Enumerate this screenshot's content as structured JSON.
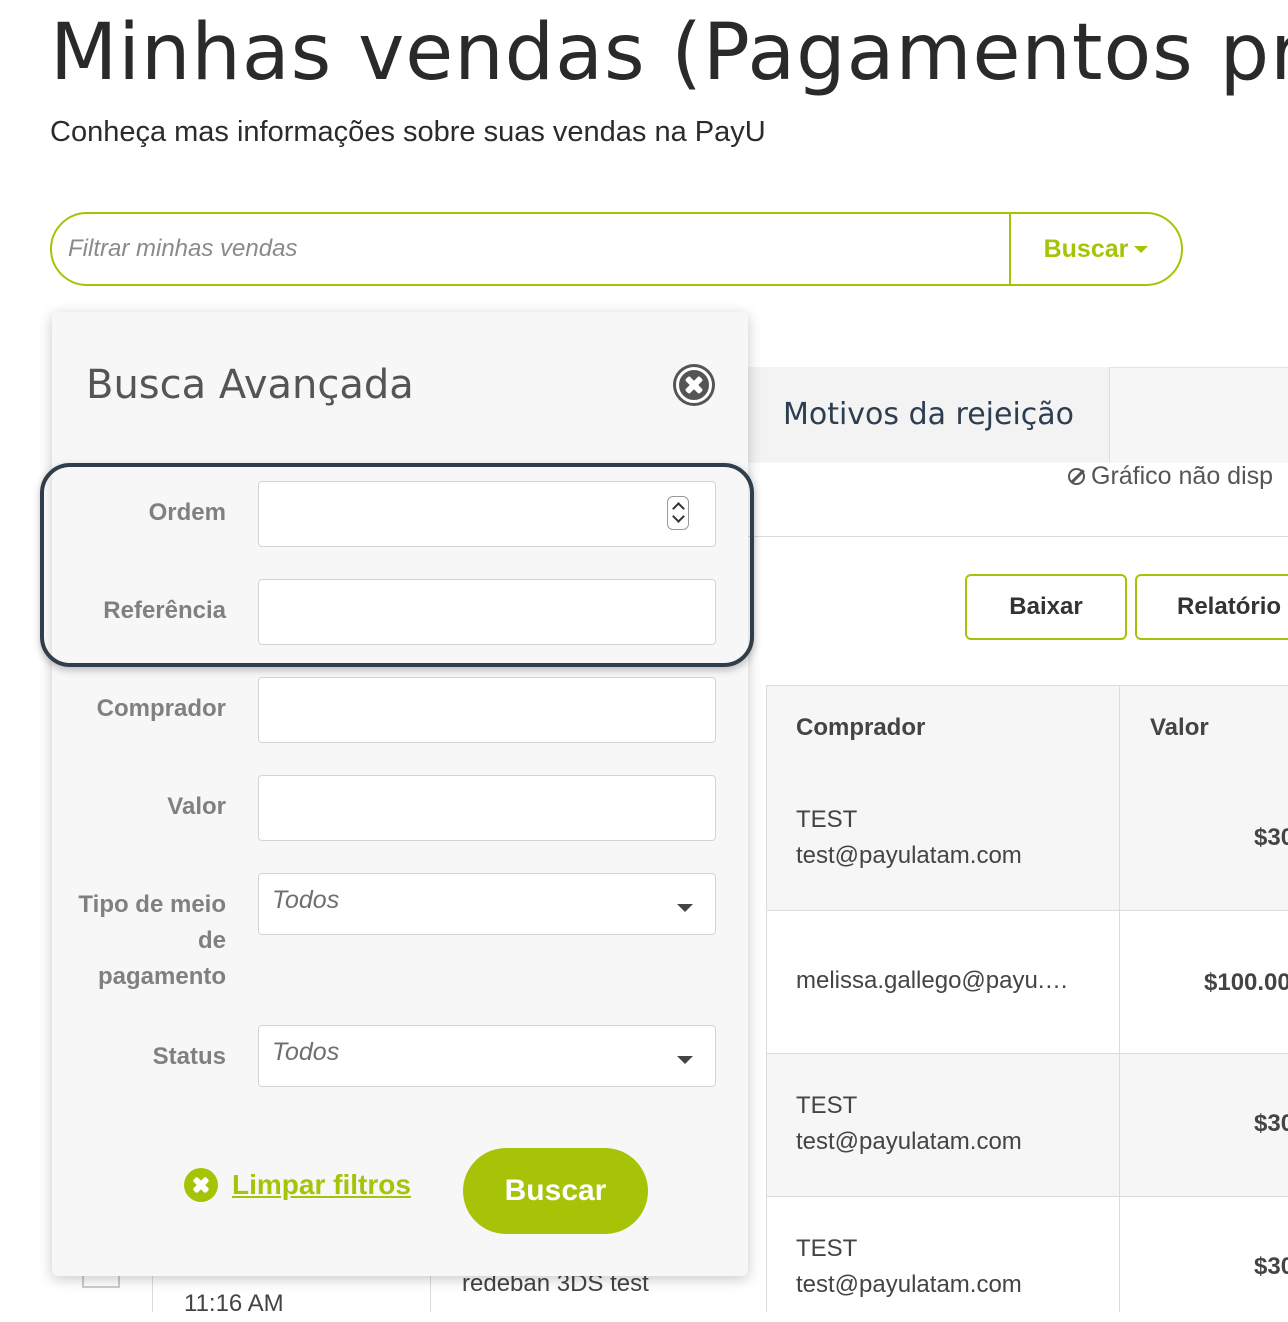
{
  "page": {
    "title": "Minhas vendas (Pagamentos pro",
    "subtitle": "Conheça mas informações sobre suas vendas na PayU"
  },
  "search": {
    "placeholder": "Filtrar minhas vendas",
    "button_label": "Buscar"
  },
  "tabs": {
    "rejection_reasons": "Motivos da rejeição"
  },
  "chart_notice": "Gráfico não disp",
  "actions": {
    "download": "Baixar",
    "report": "Relatório"
  },
  "table": {
    "headers": [
      "Comprador",
      "Valor"
    ],
    "rows": [
      {
        "buyer_name": "TEST",
        "buyer_email": "test@payulatam.com",
        "amount": "$30"
      },
      {
        "buyer_name": "",
        "buyer_email": "melissa.gallego@payu.…",
        "amount": "$100.00"
      },
      {
        "buyer_name": "TEST",
        "buyer_email": "test@payulatam.com",
        "amount": "$30"
      },
      {
        "buyer_name": "TEST",
        "buyer_email": "test@payulatam.com",
        "amount": "$30"
      }
    ],
    "partial_time": "11:16 AM",
    "partial_description": "redeban 3DS test"
  },
  "advanced_search": {
    "title": "Busca Avançada",
    "fields": {
      "order": {
        "label": "Ordem",
        "value": ""
      },
      "reference": {
        "label": "Referência",
        "value": ""
      },
      "buyer": {
        "label": "Comprador",
        "value": ""
      },
      "amount": {
        "label": "Valor",
        "value": ""
      },
      "payment_method_line1": "Tipo de meio",
      "payment_method_line2": "de",
      "payment_method_line3": "pagamento",
      "payment_method_value": "Todos",
      "status": {
        "label": "Status",
        "value": "Todos"
      }
    },
    "clear_label": "Limpar filtros",
    "submit_label": "Buscar"
  },
  "colors": {
    "accent": "#a6c307",
    "highlight_border": "#2f3e4a",
    "text_dark": "#2c3e50"
  }
}
